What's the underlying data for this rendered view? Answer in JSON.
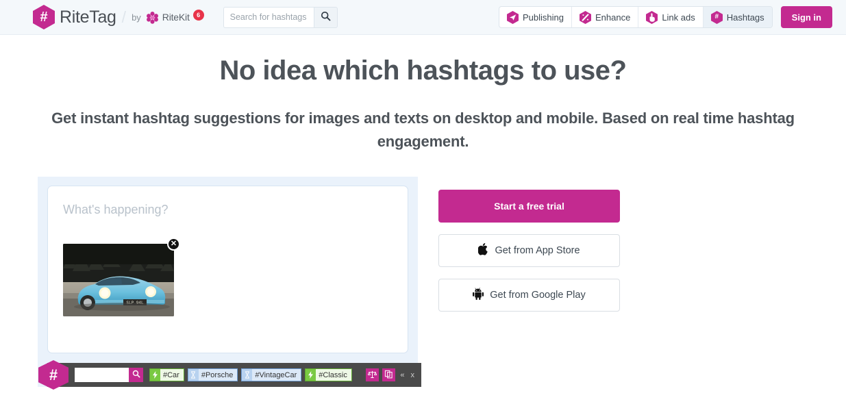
{
  "colors": {
    "brand_magenta": "#c32a90",
    "header_bg": "#f4f8fb",
    "panel_bg": "#eaf2fb",
    "toolbar_bg": "#4a4a4a",
    "badge_red": "#e8344a",
    "pill_green": "#7ac943",
    "pill_blue": "#b8d2ef",
    "heading": "#4d5359"
  },
  "header": {
    "logo_icon": "hash-hexagon-icon",
    "brand_name": "RiteTag",
    "separator": "/",
    "by_label": "by",
    "parent_icon": "ritekit-flower-icon",
    "parent_name": "RiteKit",
    "badge_count": "6",
    "search": {
      "placeholder": "Search for hashtags",
      "value": "",
      "button_icon": "search-icon"
    },
    "nav": [
      {
        "label": "Publishing",
        "icon": "paper-plane-icon",
        "active": false
      },
      {
        "label": "Enhance",
        "icon": "magic-wand-icon",
        "active": false
      },
      {
        "label": "Link ads",
        "icon": "pointing-hand-icon",
        "active": false
      },
      {
        "label": "Hashtags",
        "icon": "hash-icon",
        "active": true
      }
    ],
    "sign_in_label": "Sign in"
  },
  "hero": {
    "title": "No idea which hashtags to use?",
    "subtitle": "Get instant hashtag suggestions for images and texts on desktop and mobile. Based on real time hashtag engagement."
  },
  "composer": {
    "placeholder": "What's happening?",
    "value": "",
    "attachment": {
      "alt": "light blue vintage Porsche 911 with headlights on at dusk",
      "plate": "SLP 94L",
      "remove_icon": "close-circle-icon",
      "remove_label": "✕"
    }
  },
  "hashtag_toolbar": {
    "logo_icon": "hash-hexagon-icon",
    "logo_glyph": "#",
    "search": {
      "placeholder": "",
      "value": "",
      "button_icon": "search-icon"
    },
    "suggestions": [
      {
        "label": "#Car",
        "type": "green",
        "icon": "lightning-bolt-icon",
        "glyph": "⚡"
      },
      {
        "label": "#Porsche",
        "type": "blue",
        "icon": "hourglass-icon",
        "glyph": "⌛"
      },
      {
        "label": "#VintageCar",
        "type": "blue",
        "icon": "hourglass-icon",
        "glyph": "⌛"
      },
      {
        "label": "#Classic",
        "type": "green",
        "icon": "lightning-bolt-icon",
        "glyph": "⚡"
      }
    ],
    "actions": [
      {
        "icon": "scales-compare-icon"
      },
      {
        "icon": "copy-pages-icon"
      }
    ],
    "collapse_label": "«",
    "close_label": "x"
  },
  "cta": {
    "primary_label": "Start a free trial",
    "app_store": {
      "label": "Get from App Store",
      "icon": "apple-icon"
    },
    "google_play": {
      "label": "Get from Google Play",
      "icon": "android-icon"
    }
  }
}
